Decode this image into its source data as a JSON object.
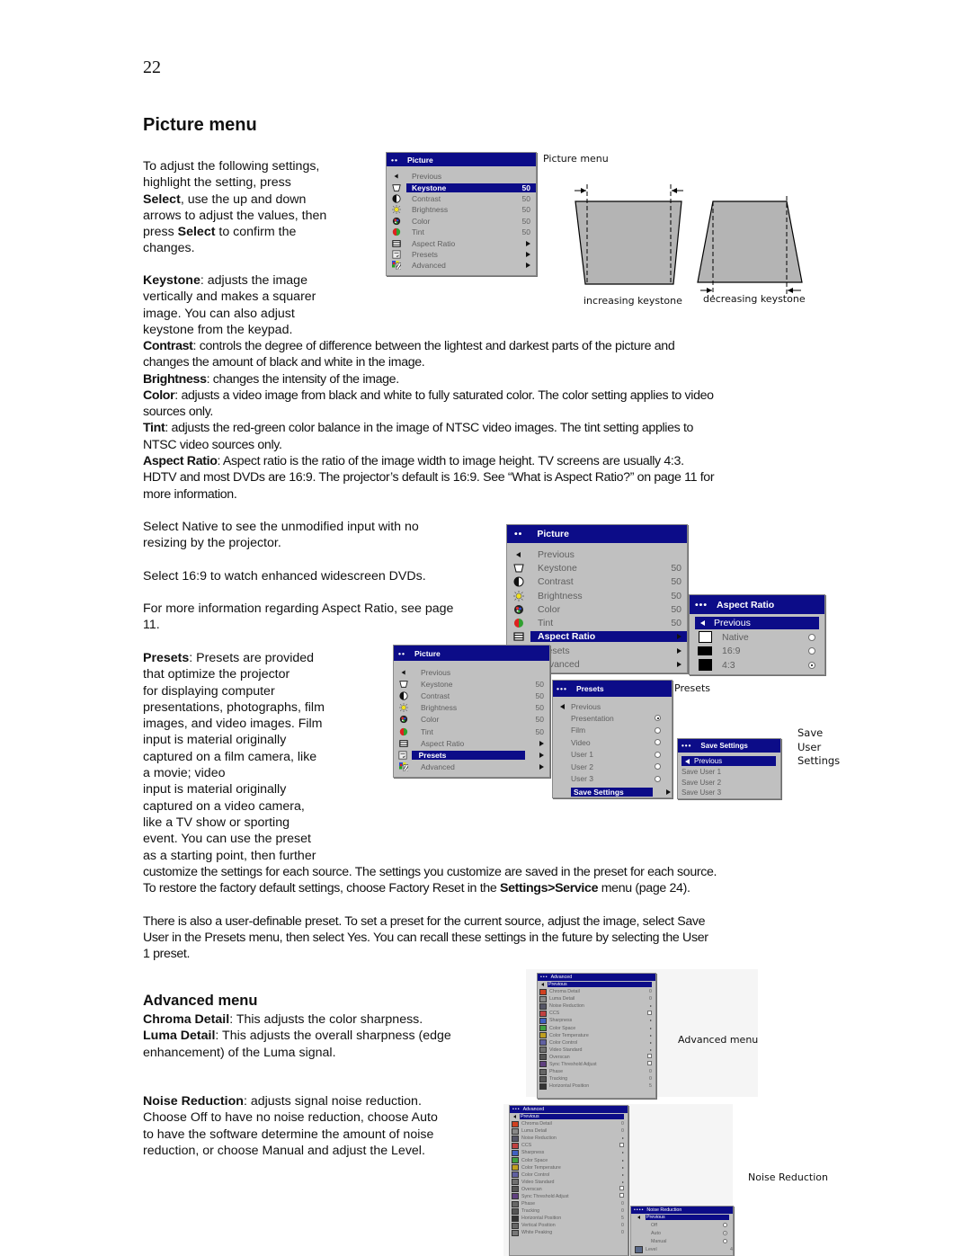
{
  "page": {
    "number": "22",
    "title": "Picture menu",
    "intro": {
      "t1": "To adjust the following settings,",
      "t2": "highlight the setting, press",
      "b1": "Select",
      "t3": ", use the up and down",
      "t4": "arrows to adjust the values, then",
      "t5": "press ",
      "b2": "Select",
      "t6": " to confirm the",
      "t7": "changes."
    },
    "keystone": {
      "term": "Keystone",
      "l1": ": adjusts the image",
      "l2": "vertically and makes a squarer",
      "l3": "image. You can also adjust",
      "l4": "keystone from the keypad."
    },
    "contrast": {
      "term": "Contrast",
      "l1": ": controls the degree of difference between the lightest and darkest parts of the picture and",
      "l2": "changes the amount of black and white in the image."
    },
    "brightness": {
      "term": "Brightness",
      "l1": ": changes the intensity of the image."
    },
    "color": {
      "term": "Color",
      "l1": ": adjusts a video image from black and white to fully saturated color. The color setting applies to video",
      "l2": "sources only."
    },
    "tint": {
      "term": "Tint",
      "l1": ": adjusts the red-green color balance in the image of NTSC video images. The tint setting applies to",
      "l2": "NTSC video sources only."
    },
    "aspect": {
      "term": "Aspect Ratio",
      "l1": ": Aspect ratio is the ratio of the image width to image height. TV screens are usually 4:3.",
      "l2": "HDTV and most DVDs are 16:9. The projector’s default is 16:9. See “What is Aspect Ratio?” on page 11 for",
      "l3": "more information."
    },
    "native": {
      "l1": "Select Native to see the unmodified input with no",
      "l2": "resizing by the projector."
    },
    "widescreen": "Select 16:9 to watch enhanced widescreen DVDs.",
    "moreinfo": {
      "l1": "For more information regarding Aspect Ratio, see page",
      "l2": "11."
    },
    "presets": {
      "term": "Presets",
      "l1": ": Presets are provided",
      "l2": "that optimize the projector",
      "l3": "for displaying computer",
      "l4": "presentations, photographs, film",
      "l5": "images, and video images. Film",
      "l6": "input is material originally",
      "l7": "captured on a film camera, like",
      "l8": "a movie; video",
      "l9": "input is material originally",
      "l10": "captured on a video camera,",
      "l11": "like a TV show or sporting",
      "l12": "event. You can use the preset",
      "l13": "as a starting point, then further",
      "l14": "customize the settings for each source. The settings you customize are saved in the preset for each source.",
      "l15a": "To restore the factory default settings, choose Factory Reset in the ",
      "l15b": "Settings>Service",
      "l15c": " menu (page 24)."
    },
    "userpreset": {
      "l1": "There is also a user-definable preset. To set a preset for the current source, adjust the image, select Save",
      "l2": "User in the Presets menu, then select Yes. You can recall these settings in the future by selecting the User",
      "l3": "1 preset."
    },
    "advanced_title": "Advanced menu",
    "chroma": {
      "term": "Chroma Detail",
      "l1": ": This adjusts the color sharpness."
    },
    "luma": {
      "term": "Luma Detail",
      "l1": ": This adjusts the overall sharpness (edge",
      "l2": "enhancement) of the Luma signal."
    },
    "noise": {
      "term": "Noise Reduction",
      "l1": ": adjusts signal noise reduction.",
      "l2": "Choose Off to have no noise reduction, choose Auto",
      "l3": "to have the software determine the amount of noise",
      "l4": "reduction, or choose Manual and adjust the Level."
    }
  },
  "captions": {
    "picture_menu": "Picture menu",
    "increasing": "increasing keystone",
    "decreasing": "decreasing keystone",
    "presets": "Presets",
    "save1": "Save",
    "save2": "User",
    "save3": "Settings",
    "advanced": "Advanced menu",
    "noise": "Noise Reduction"
  },
  "picture_menu": {
    "dots": "••",
    "title": "Picture",
    "items": [
      {
        "label": "Previous",
        "value": "",
        "icon": "back-arrow"
      },
      {
        "label": "Keystone",
        "value": "50",
        "icon": "keystone"
      },
      {
        "label": "Contrast",
        "value": "50",
        "icon": "contrast"
      },
      {
        "label": "Brightness",
        "value": "50",
        "icon": "brightness"
      },
      {
        "label": "Color",
        "value": "50",
        "icon": "color"
      },
      {
        "label": "Tint",
        "value": "50",
        "icon": "tint"
      },
      {
        "label": "Aspect Ratio",
        "value": "▶",
        "icon": "aspect-ratio"
      },
      {
        "label": "Presets",
        "value": "▶",
        "icon": "presets"
      },
      {
        "label": "Advanced",
        "value": "▶",
        "icon": "advanced"
      }
    ]
  },
  "aspect_menu": {
    "dots": "•••",
    "title": "Aspect Ratio",
    "previous": "Previous",
    "options": [
      {
        "label": "Native",
        "selected": false
      },
      {
        "label": "16:9",
        "selected": false
      },
      {
        "label": "4:3",
        "selected": true
      }
    ]
  },
  "presets_menu": {
    "dots": "•••",
    "title": "Presets",
    "previous": "Previous",
    "options": [
      {
        "label": "Presentation",
        "selected": true
      },
      {
        "label": "Film",
        "selected": false
      },
      {
        "label": "Video",
        "selected": false
      },
      {
        "label": "User 1",
        "selected": false
      },
      {
        "label": "User 2",
        "selected": false
      },
      {
        "label": "User 3",
        "selected": false
      }
    ],
    "save_settings": "Save Settings"
  },
  "save_menu": {
    "dots": "•••",
    "title": "Save Settings",
    "previous": "Previous",
    "items": [
      "Save User 1",
      "Save User 2",
      "Save User 3"
    ]
  },
  "advanced_menu": {
    "dots": "•••",
    "title": "Advanced",
    "previous": "Previous",
    "items": [
      {
        "label": "Chroma Detail",
        "value": "0",
        "kind": "value"
      },
      {
        "label": "Luma Detail",
        "value": "0",
        "kind": "value"
      },
      {
        "label": "Noise Reduction",
        "value": "▶",
        "kind": "arrow"
      },
      {
        "label": "CCS",
        "value": "",
        "kind": "check"
      },
      {
        "label": "Sharpness",
        "value": "▶",
        "kind": "arrow"
      },
      {
        "label": "Color Space",
        "value": "▶",
        "kind": "arrow"
      },
      {
        "label": "Color Temperature",
        "value": "▶",
        "kind": "arrow"
      },
      {
        "label": "Color Control",
        "value": "▶",
        "kind": "arrow"
      },
      {
        "label": "Video Standard",
        "value": "▶",
        "kind": "arrow"
      },
      {
        "label": "Overscan",
        "value": "",
        "kind": "check"
      },
      {
        "label": "Sync Threshold Adjust",
        "value": "",
        "kind": "check"
      },
      {
        "label": "Phase",
        "value": "0",
        "kind": "value"
      },
      {
        "label": "Tracking",
        "value": "0",
        "kind": "value"
      },
      {
        "label": "Horizontal Position",
        "value": "5",
        "kind": "value"
      },
      {
        "label": "Vertical Position",
        "value": "0",
        "kind": "value"
      },
      {
        "label": "White Peaking",
        "value": "0",
        "kind": "value"
      }
    ]
  },
  "noise_menu": {
    "dots": "••••",
    "title": "Noise Reduction",
    "previous": "Previous",
    "options": [
      {
        "label": "Off",
        "selected": false
      },
      {
        "label": "Auto",
        "selected": true
      },
      {
        "label": "Manual",
        "selected": false
      }
    ],
    "level_label": "Level",
    "level_value": "4"
  },
  "colors": {
    "menu_title_bg": "#0c0c88",
    "menu_bg": "#c0c0c0",
    "keystone_fill": "#b4b4b4"
  }
}
